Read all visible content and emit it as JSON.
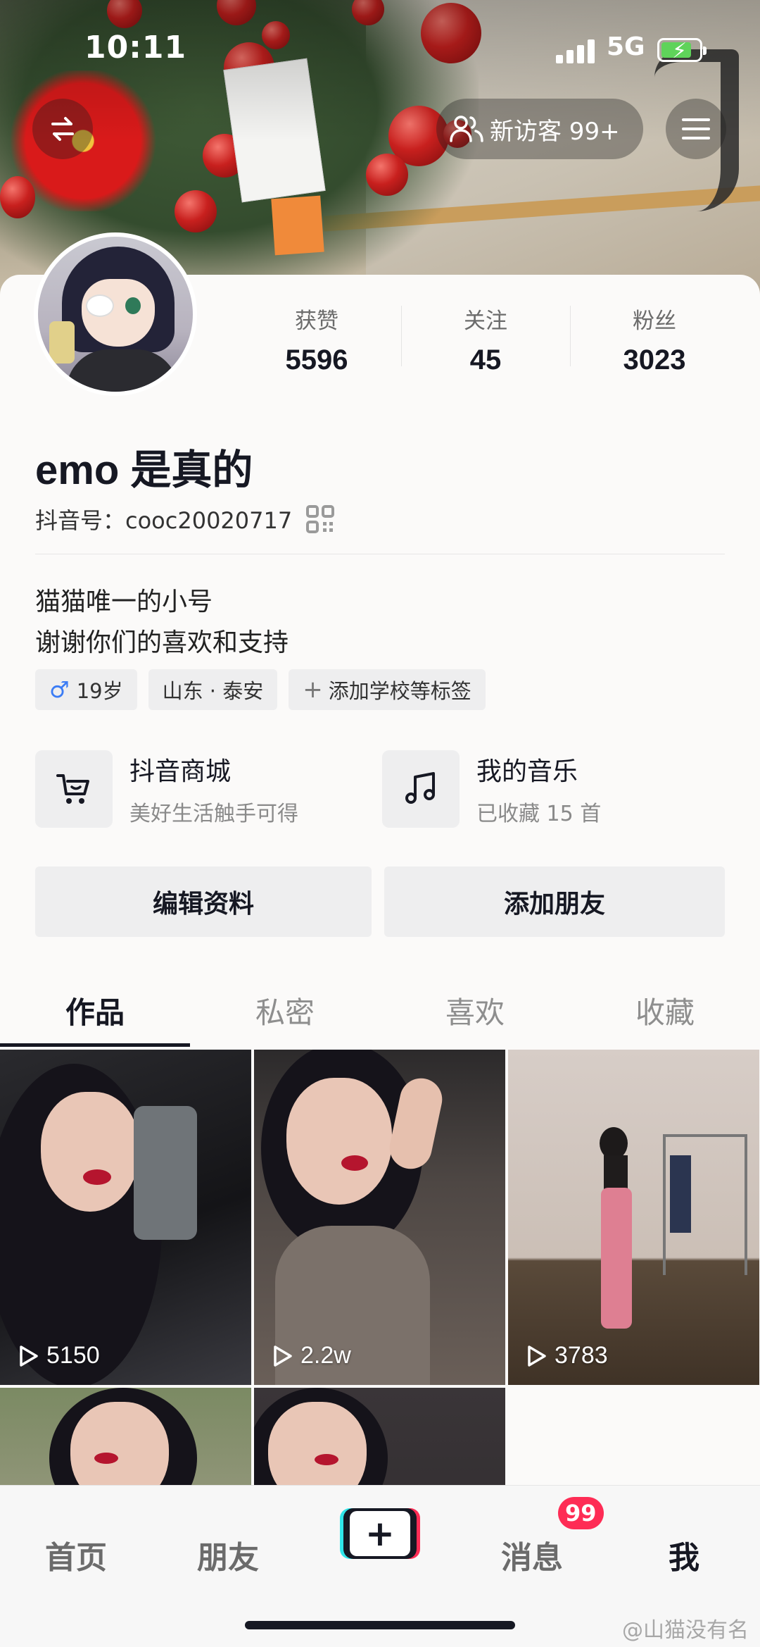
{
  "status_bar": {
    "time": "10:11",
    "network": "5G",
    "battery_level": 0.8
  },
  "header": {
    "visitor_label": "新访客 99+",
    "icons": {
      "switch": "switch-account-icon",
      "visitor": "visitors-icon",
      "menu": "hamburger-menu-icon"
    }
  },
  "profile": {
    "nickname": "emo 是真的",
    "douyin_id": "抖音号：cooc20020717",
    "stats": [
      {
        "label": "获赞",
        "value": "5596"
      },
      {
        "label": "关注",
        "value": "45"
      },
      {
        "label": "粉丝",
        "value": "3023"
      }
    ],
    "bio": [
      "猫猫唯一的小号",
      "谢谢你们的喜欢和支持"
    ],
    "tags": {
      "age": "19岁",
      "location": "山东 · 泰安",
      "add": "添加学校等标签"
    }
  },
  "shortcuts": [
    {
      "title": "抖音商城",
      "subtitle": "美好生活触手可得",
      "icon": "shopping-cart-icon"
    },
    {
      "title": "我的音乐",
      "subtitle": "已收藏 15 首",
      "icon": "music-note-icon"
    }
  ],
  "actions": {
    "edit": "编辑资料",
    "add_friend": "添加朋友"
  },
  "tabs": [
    {
      "label": "作品",
      "active": true
    },
    {
      "label": "私密",
      "active": false
    },
    {
      "label": "喜欢",
      "active": false
    },
    {
      "label": "收藏",
      "active": false
    }
  ],
  "videos": [
    {
      "plays": "5150"
    },
    {
      "plays": "2.2w"
    },
    {
      "plays": "3783"
    },
    {
      "plays": ""
    },
    {
      "plays": ""
    }
  ],
  "bottom_nav": {
    "home": "首页",
    "friends": "朋友",
    "create": "+",
    "messages": "消息",
    "messages_badge": "99",
    "me": "我"
  },
  "watermark": "@山猫没有名",
  "colors": {
    "accent": "#fe2c55",
    "text": "#161823",
    "tag_male": "#3b7cf5"
  }
}
